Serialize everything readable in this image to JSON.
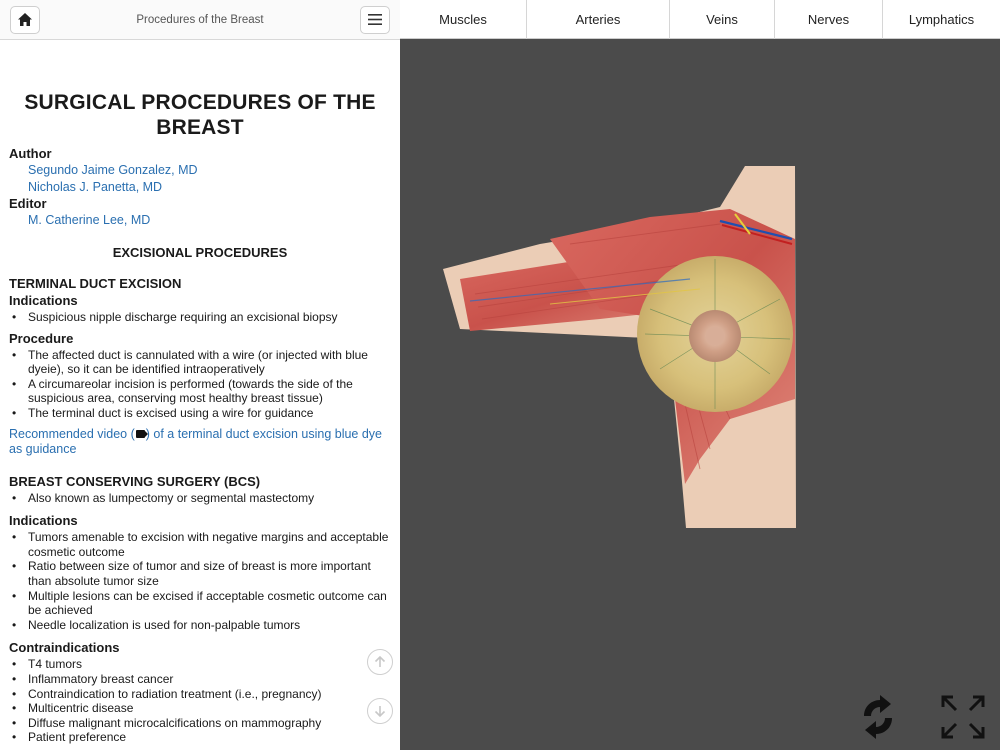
{
  "header": {
    "title": "Procedures of the Breast",
    "home_icon": "home-icon",
    "menu_icon": "menu-icon"
  },
  "doc": {
    "title": "SURGICAL PROCEDURES OF THE BREAST",
    "author_label": "Author",
    "authors": [
      "Segundo Jaime Gonzalez, MD",
      "Nicholas J. Panetta, MD"
    ],
    "editor_label": "Editor",
    "editors": [
      "M. Catherine Lee, MD"
    ],
    "section1": {
      "title": "EXCISIONAL PROCEDURES",
      "sub": "TERMINAL DUCT EXCISION",
      "indications_label": "Indications",
      "indications": [
        "Suspicious nipple discharge requiring an excisional biopsy"
      ],
      "procedure_label": "Procedure",
      "procedure": [
        "The affected duct is cannulated with a wire (or injected with blue dyeie), so it can be identified intraoperatively",
        "A circumareolar incision is performed (towards the side of the suspicious area, conserving most healthy breast tissue)",
        "The terminal duct is excised using a wire for guidance"
      ],
      "video_pre": "Recommended video (",
      "video_post": ") of a terminal duct excision using blue dye as guidance"
    },
    "section2": {
      "sub": "BREAST CONSERVING SURGERY (BCS)",
      "aka": [
        "Also known as lumpectomy or segmental mastectomy"
      ],
      "indications_label": "Indications",
      "indications": [
        "Tumors amenable to excision with negative margins and acceptable cosmetic outcome",
        "Ratio between size of tumor and size of breast is more important than absolute tumor size",
        "Multiple lesions can be excised if acceptable cosmetic outcome can be achieved",
        "Needle localization is used for non-palpable tumors"
      ],
      "contra_label": "Contraindications",
      "contra": [
        "T4 tumors",
        "Inflammatory breast cancer",
        "Contraindication to radiation treatment (i.e., pregnancy)",
        "Multicentric disease",
        "Diffuse malignant microcalcifications on mammography",
        "Patient preference"
      ]
    }
  },
  "tabs": [
    "Muscles",
    "Arteries",
    "Veins",
    "Nerves",
    "Lymphatics"
  ],
  "controls": {
    "scroll_up_icon": "arrow-up-circle-icon",
    "scroll_down_icon": "arrow-down-circle-icon",
    "rotate_icon": "rotate-icon",
    "fullscreen_icon": "fullscreen-icon"
  }
}
